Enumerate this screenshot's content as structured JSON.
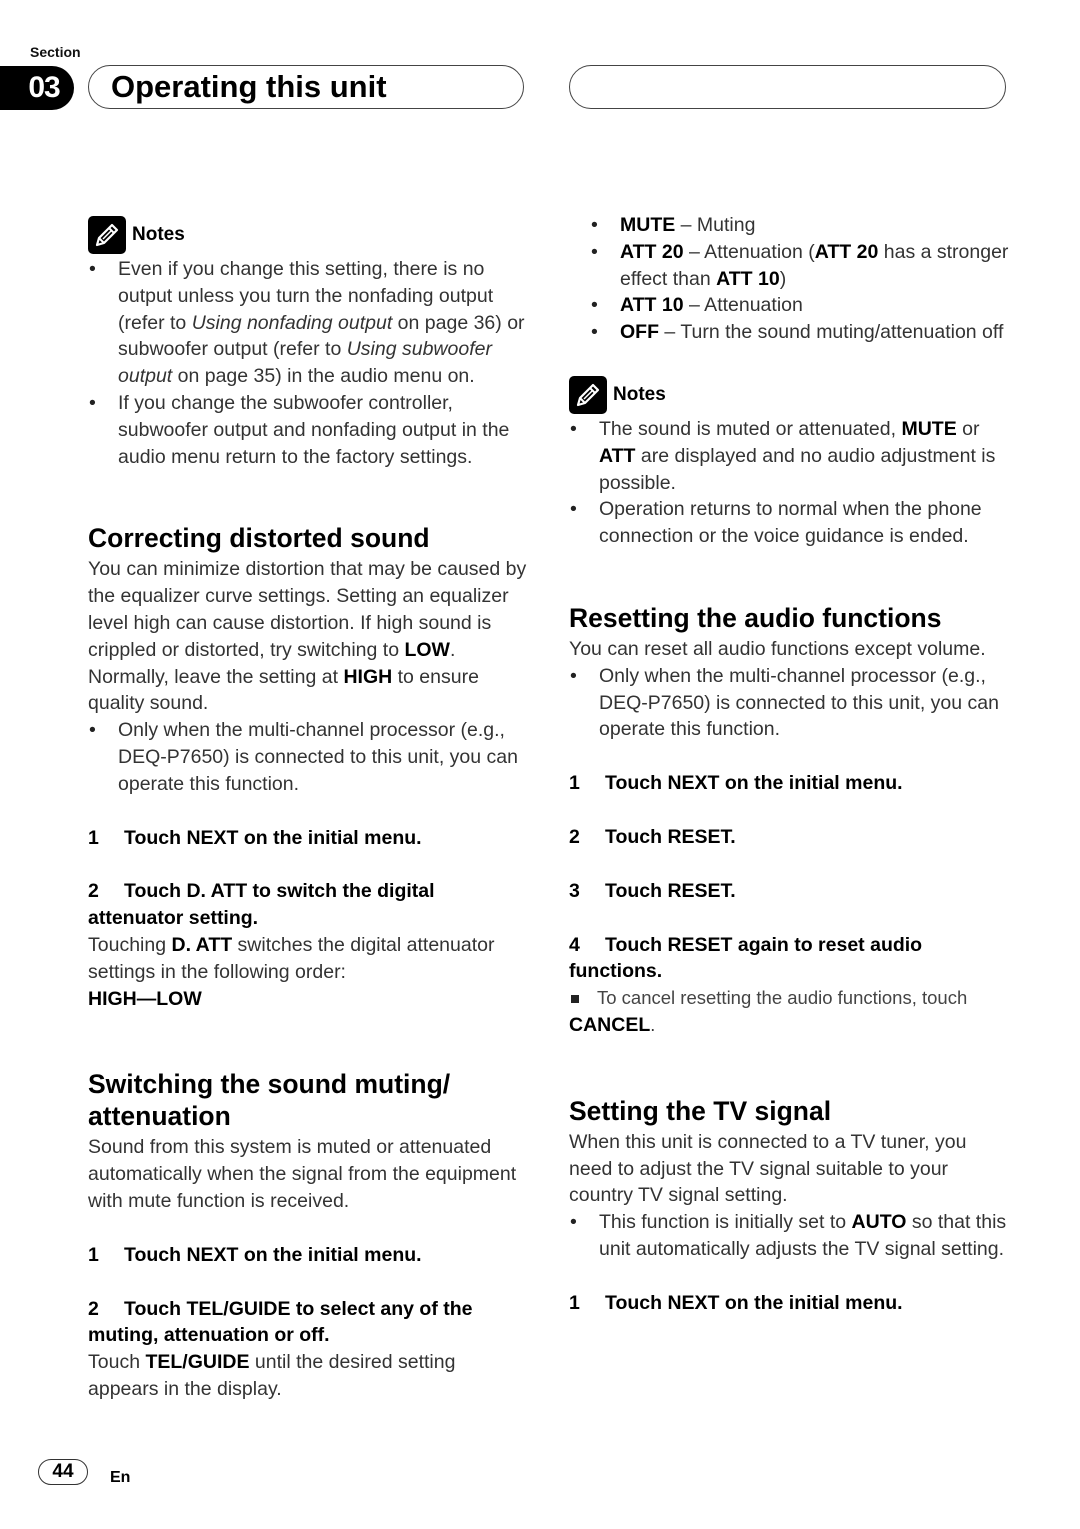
{
  "header": {
    "section_label": "Section",
    "section_number": "03",
    "title": "Operating this unit"
  },
  "left": {
    "notes": {
      "icon": "pencil-note-icon",
      "title": "Notes",
      "b1_pre": "Even if you change this setting, there is no output unless you turn the nonfading output (refer to ",
      "b1_i1": "Using nonfading output",
      "b1_mid": " on page 36) or subwoofer output (refer to ",
      "b1_i2": "Using subwoofer output",
      "b1_post": " on page 35) in the audio menu on.",
      "b2": "If you change the subwoofer controller, subwoofer output and nonfading output in the audio menu return to the factory settings."
    },
    "correcting": {
      "heading": "Correcting distorted sound",
      "p_pre": "You can minimize distortion that may be caused by the equalizer curve settings. Setting an equalizer level high can cause distortion. If high sound is crippled or distorted, try switching to ",
      "p_low": "LOW",
      "p_mid": ". Normally, leave the setting at ",
      "p_high": "HIGH",
      "p_post": " to ensure quality sound.",
      "bullet": "Only when the multi-channel processor (e.g., DEQ-P7650) is connected to this unit, you can operate this function.",
      "step1_num": "1",
      "step1": "Touch NEXT on the initial menu.",
      "step2_num": "2",
      "step2": "Touch D. ATT to switch the digital attenuator setting.",
      "desc_pre": "Touching ",
      "desc_bold": "D. ATT",
      "desc_post": " switches the digital attenuator settings in the following order:",
      "sequence": "HIGH—LOW"
    },
    "muting": {
      "heading": "Switching the sound muting/ attenuation",
      "p": "Sound from this system is muted or attenuated automatically when the signal from the equipment with mute function is received.",
      "step1_num": "1",
      "step1": "Touch NEXT on the initial menu.",
      "step2_num": "2",
      "step2": "Touch TEL/GUIDE to select any of the muting, attenuation or off.",
      "desc_pre": "Touch ",
      "desc_bold": "TEL/GUIDE",
      "desc_post": " until the desired setting appears in the display."
    }
  },
  "right": {
    "options": [
      {
        "key": "MUTE",
        "desc": " – Muting"
      },
      {
        "key": "ATT 20",
        "desc": " – Attenuation (",
        "key2": "ATT 20",
        "desc2": " has a stronger effect than ",
        "key3": "ATT 10",
        "desc3": ")"
      },
      {
        "key": "ATT 10",
        "desc": " – Attenuation"
      },
      {
        "key": "OFF",
        "desc": " – Turn the sound muting/attenuation off"
      }
    ],
    "notes": {
      "icon": "pencil-note-icon",
      "title": "Notes",
      "b1_pre": "The sound is muted or attenuated, ",
      "b1_k1": "MUTE",
      "b1_mid": " or ",
      "b1_k2": "ATT",
      "b1_post": " are displayed and no audio adjustment is possible.",
      "b2": "Operation returns to normal when the phone connection or the voice guidance is ended."
    },
    "resetting": {
      "heading": "Resetting the audio functions",
      "p": "You can reset all audio functions except volume.",
      "bullet": "Only when the multi-channel processor (e.g., DEQ-P7650) is connected to this unit, you can operate this function.",
      "steps": [
        {
          "num": "1",
          "text": "Touch NEXT on the initial menu."
        },
        {
          "num": "2",
          "text": "Touch RESET."
        },
        {
          "num": "3",
          "text": "Touch RESET."
        },
        {
          "num": "4",
          "text": "Touch RESET again to reset audio functions."
        }
      ],
      "cancel_pre": "To cancel resetting the audio functions, touch ",
      "cancel_bold": "CANCEL",
      "cancel_post": "."
    },
    "tv": {
      "heading": "Setting the TV signal",
      "p": "When this unit is connected to a TV tuner, you need to adjust the TV signal suitable to your country TV signal setting.",
      "b_pre": "This function is initially set to ",
      "b_bold": "AUTO",
      "b_post": " so that this unit automatically adjusts the TV signal setting.",
      "step1_num": "1",
      "step1": "Touch NEXT on the initial menu."
    }
  },
  "footer": {
    "page_number": "44",
    "language": "En"
  }
}
